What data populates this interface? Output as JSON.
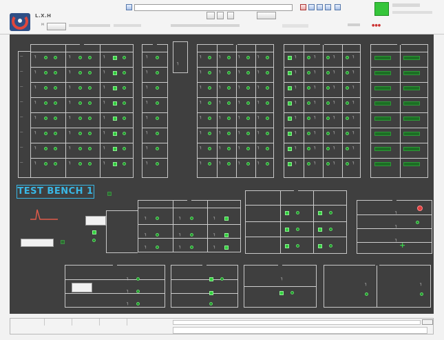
{
  "app": {
    "title": "L.X.H"
  },
  "header": {
    "buttons": [
      "",
      "",
      "",
      "",
      ""
    ],
    "tab_label": "M",
    "path_text": "\\\\\\\\...........",
    "status_label": "",
    "user_label": ""
  },
  "panel": {
    "test_bench_label": "TEST BENCH 1",
    "group_titles": [
      "",
      "",
      "",
      "",
      "",
      "",
      "",
      "",
      "",
      "",
      "",
      "",
      "",
      "",
      ""
    ],
    "row_labels": [
      "",
      "",
      "",
      "",
      "",
      "",
      "",
      ""
    ],
    "left_button": "",
    "bottom_left_button": "",
    "lower_left_button": ""
  },
  "footer": {
    "cells": [
      "",
      "",
      "",
      ""
    ],
    "input_label": "",
    "right_button": ""
  },
  "colors": {
    "panel": "#3f3f3f",
    "accent_green": "#33cf3e",
    "title_blue": "#38b7e6",
    "alarm_red": "#e14040"
  }
}
